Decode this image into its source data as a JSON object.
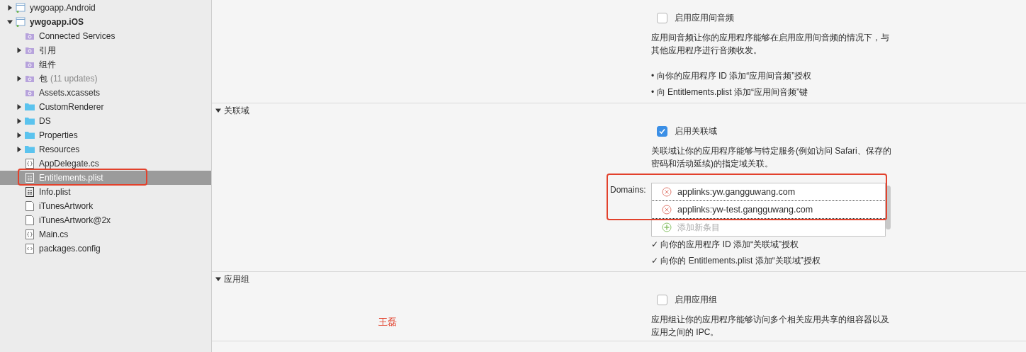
{
  "sidebar": {
    "tree": [
      {
        "label": "ywgoapp.Android",
        "kind": "project",
        "expandable": true,
        "expanded": false,
        "startup": false,
        "selected": false,
        "annotated": false
      },
      {
        "label": "ywgoapp.iOS",
        "kind": "project",
        "expandable": true,
        "expanded": true,
        "startup": true,
        "selected": false,
        "annotated": false,
        "children": [
          {
            "label": "Connected Services",
            "kind": "services",
            "expandable": false,
            "expanded": false,
            "startup": false,
            "selected": false,
            "annotated": false
          },
          {
            "label": "引用",
            "kind": "special-folder",
            "expandable": true,
            "expanded": false,
            "startup": false,
            "selected": false,
            "annotated": false
          },
          {
            "label": "组件",
            "kind": "special-folder",
            "expandable": false,
            "expanded": false,
            "startup": false,
            "selected": false,
            "annotated": false
          },
          {
            "label": "包",
            "note": "(11 updates)",
            "kind": "special-folder",
            "expandable": true,
            "expanded": false,
            "startup": false,
            "selected": false,
            "annotated": false
          },
          {
            "label": "Assets.xcassets",
            "kind": "assets",
            "expandable": false,
            "expanded": false,
            "startup": false,
            "selected": false,
            "annotated": false
          },
          {
            "label": "CustomRenderer",
            "kind": "folder",
            "expandable": true,
            "expanded": false,
            "startup": false,
            "selected": false,
            "annotated": false
          },
          {
            "label": "DS",
            "kind": "folder",
            "expandable": true,
            "expanded": false,
            "startup": false,
            "selected": false,
            "annotated": false
          },
          {
            "label": "Properties",
            "kind": "folder",
            "expandable": true,
            "expanded": false,
            "startup": false,
            "selected": false,
            "annotated": false
          },
          {
            "label": "Resources",
            "kind": "folder",
            "expandable": true,
            "expanded": false,
            "startup": false,
            "selected": false,
            "annotated": false
          },
          {
            "label": "AppDelegate.cs",
            "kind": "code",
            "expandable": false,
            "expanded": false,
            "startup": false,
            "selected": false,
            "annotated": false
          },
          {
            "label": "Entitlements.plist",
            "kind": "plist",
            "expandable": false,
            "expanded": false,
            "startup": false,
            "selected": true,
            "annotated": true
          },
          {
            "label": "Info.plist",
            "kind": "plist",
            "expandable": false,
            "expanded": false,
            "startup": false,
            "selected": false,
            "annotated": false
          },
          {
            "label": "iTunesArtwork",
            "kind": "file",
            "expandable": false,
            "expanded": false,
            "startup": false,
            "selected": false,
            "annotated": false
          },
          {
            "label": "iTunesArtwork@2x",
            "kind": "file",
            "expandable": false,
            "expanded": false,
            "startup": false,
            "selected": false,
            "annotated": false
          },
          {
            "label": "Main.cs",
            "kind": "code",
            "expandable": false,
            "expanded": false,
            "startup": false,
            "selected": false,
            "annotated": false
          },
          {
            "label": "packages.config",
            "kind": "config",
            "expandable": false,
            "expanded": false,
            "startup": false,
            "selected": false,
            "annotated": false
          }
        ]
      }
    ]
  },
  "sections": [
    {
      "expanded": true,
      "enable": {
        "label": "启用应用间音频",
        "checked": false
      },
      "description": "应用间音频让你的应用程序能够在启用应用间音频的情况下，与其他应用程序进行音频收发。",
      "requirements": [
        {
          "marker": "•",
          "text": "向你的应用程序 ID 添加“应用间音频”授权"
        },
        {
          "marker": "•",
          "text": "向 Entitlements.plist 添加“应用间音频”键"
        }
      ]
    },
    {
      "title": "关联域",
      "expanded": true,
      "enable": {
        "label": "启用关联域",
        "checked": true
      },
      "description": "关联域让你的应用程序能够与特定服务(例如访问 Safari、保存的密码和活动延续)的指定域关联。",
      "domains": {
        "label": "Domains:",
        "annotated": true,
        "items": [
          {
            "value": "applinks:yw.gangguwang.com"
          },
          {
            "value": "applinks:yw-test.gangguwang.com"
          }
        ],
        "add_label": "添加新条目"
      },
      "requirements": [
        {
          "marker": "✓",
          "text": "向你的应用程序 ID 添加“关联域”授权"
        },
        {
          "marker": "✓",
          "text": "向你的 Entitlements.plist 添加“关联域”授权"
        }
      ]
    },
    {
      "title": "应用组",
      "expanded": true,
      "annotation": "王磊",
      "enable": {
        "label": "启用应用组",
        "checked": false
      },
      "description": "应用组让你的应用程序能够访问多个相关应用共享的组容器以及应用之间的 IPC。"
    }
  ]
}
